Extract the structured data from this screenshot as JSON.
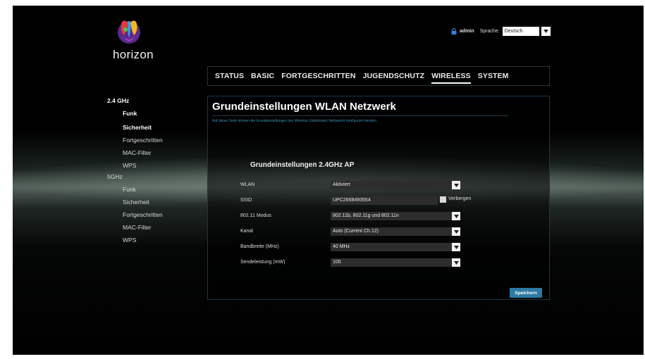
{
  "brand": {
    "name": "horizon"
  },
  "topbar": {
    "user": "admin",
    "language_label": "Sprache:",
    "language_value": "Deutsch"
  },
  "nav": {
    "tabs": [
      "STATUS",
      "BASIC",
      "FORTGESCHRITTEN",
      "JUGENDSCHUTZ",
      "WIRELESS",
      "SYSTEM"
    ],
    "active": "WIRELESS"
  },
  "sidebar": {
    "band24": {
      "label": "2.4 GHz",
      "items": [
        "Funk",
        "Sicherheit",
        "Fortgeschritten",
        "MAC-Filter",
        "WPS"
      ]
    },
    "band5": {
      "label": "5GHz",
      "items": [
        "Funk",
        "Sicherheit",
        "Fortgeschritten",
        "MAC-Filter",
        "WPS"
      ]
    }
  },
  "panel": {
    "title": "Grundeinstellungen WLAN Netzwerk",
    "description": "Auf dieser Seite können die Grundeinstellungen des Wireless (drahtlosen) Netzwerks konfiguriert werden.",
    "section_title": "Grundeinstellungen 2.4GHz AP",
    "fields": {
      "wlan": {
        "label": "WLAN",
        "value": "Aktiviert"
      },
      "ssid": {
        "label": "SSID",
        "value": "UPC2668493554",
        "hide_label": "Verbergen"
      },
      "mode": {
        "label": "802.11 Modus",
        "value": "802.11b, 802.11g und 802.11n"
      },
      "channel": {
        "label": "Kanal",
        "value": "Auto (Current Ch.12)"
      },
      "bandwidth": {
        "label": "Bandbreite (MHz)",
        "value": "40 MHz"
      },
      "power": {
        "label": "Sendeleistung (mW)",
        "value": "100"
      }
    },
    "save_label": "Speichern"
  },
  "colors": {
    "accent": "#2c7aa3",
    "link": "#3c8fb8",
    "panel_border": "#17384a"
  }
}
